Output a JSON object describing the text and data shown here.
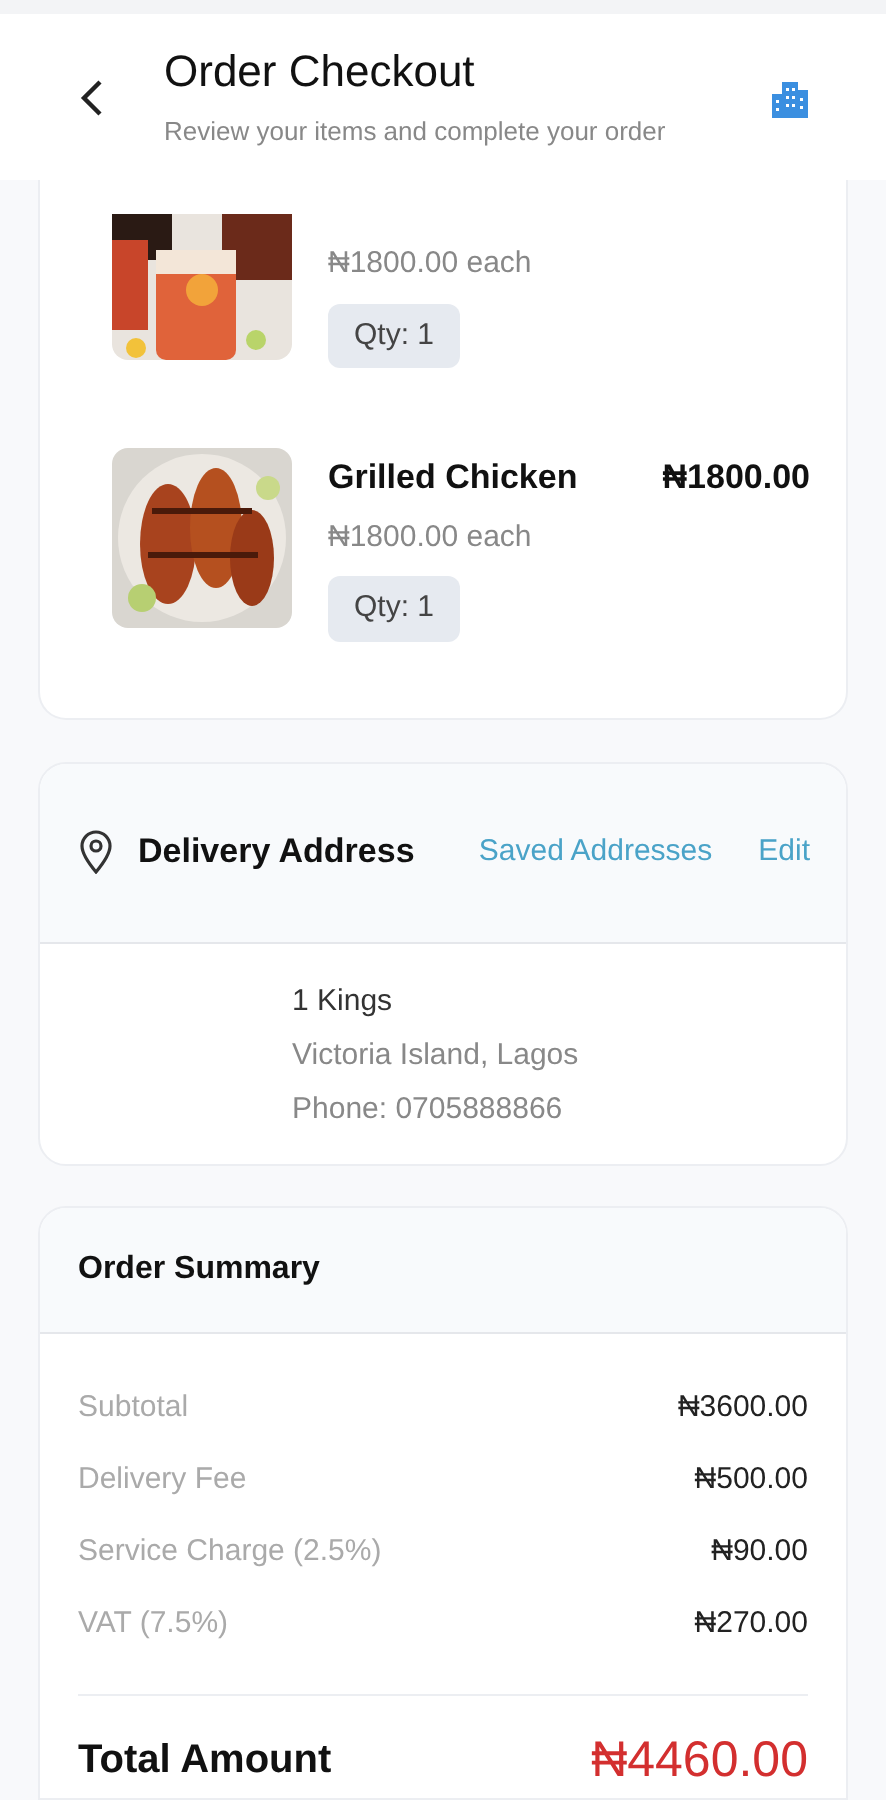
{
  "header": {
    "title": "Order Checkout",
    "subtitle": "Review your items and complete your order"
  },
  "items": [
    {
      "kind": "drink",
      "unit_price": "₦1800.00 each",
      "quantity": "Qty: 1"
    },
    {
      "kind": "chicken",
      "name": "Grilled Chicken",
      "price": "₦1800.00",
      "unit_price": "₦1800.00 each",
      "quantity": "Qty: 1"
    }
  ],
  "delivery": {
    "title": "Delivery Address",
    "saved_link": "Saved Addresses",
    "edit_link": "Edit",
    "lines": [
      "1 Kings",
      "Victoria Island, Lagos",
      "Phone: 0705888866"
    ]
  },
  "summary": {
    "title": "Order Summary",
    "rows": [
      {
        "label": "Subtotal",
        "value": "₦3600.00"
      },
      {
        "label": "Delivery Fee",
        "value": "₦500.00"
      },
      {
        "label": "Service Charge (2.5%)",
        "value": "₦90.00"
      },
      {
        "label": "VAT (7.5%)",
        "value": "₦270.00"
      }
    ],
    "total_label": "Total Amount",
    "total_value": "₦4460.00"
  }
}
